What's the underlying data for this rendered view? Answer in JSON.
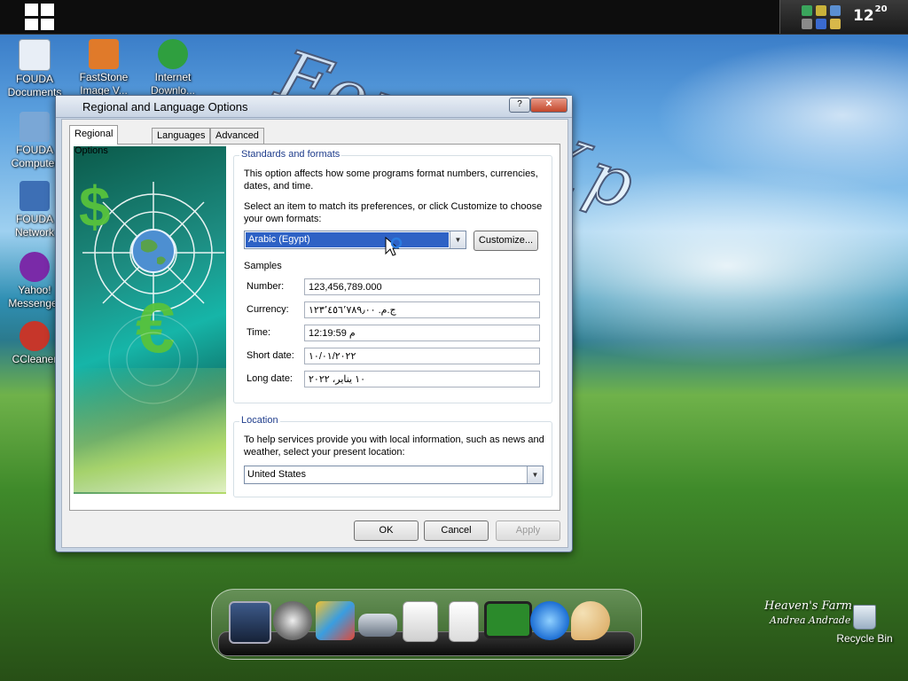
{
  "taskbar": {
    "clock_hour": "12",
    "clock_minute": "20"
  },
  "desktop_watermark": "Fouda Xp",
  "desktop_icons": [
    {
      "label": "FOUDA Documents",
      "icon": "documents-icon",
      "color": "#e8eef6"
    },
    {
      "label": "FastStone Image V...",
      "icon": "faststone-icon",
      "color": "#e07a2a"
    },
    {
      "label": "Internet Downlo...",
      "icon": "idm-icon",
      "color": "#2f9f3f"
    },
    {
      "label": "FOUDA Computer",
      "icon": "computer-icon",
      "color": "#7aa7d6"
    },
    {
      "label": "FOUDA Network",
      "icon": "network-icon",
      "color": "#3d6fb5"
    },
    {
      "label": "Yahoo! Messenger",
      "icon": "yahoo-messenger-icon",
      "color": "#7a2aa8"
    },
    {
      "label": "CCleaner",
      "icon": "ccleaner-icon",
      "color": "#c6362a"
    }
  ],
  "dialog": {
    "title": "Regional and Language Options",
    "help_label": "?",
    "close_label": "✕",
    "tabs": [
      "Regional Options",
      "Languages",
      "Advanced"
    ],
    "standards": {
      "legend": "Standards and formats",
      "desc": "This option affects how some programs format numbers, currencies, dates, and time.",
      "select_prompt": "Select an item to match its preferences, or click Customize to choose your own formats:",
      "selected_format": "Arabic (Egypt)",
      "customize_label": "Customize...",
      "samples_label": "Samples",
      "samples": [
        {
          "label": "Number:",
          "value": "123,456,789.000"
        },
        {
          "label": "Currency:",
          "value": "ج.م.‏ ١٢٣٬٤٥٦٬٧٨٩٫٠٠"
        },
        {
          "label": "Time:",
          "value": "12:19:59 م"
        },
        {
          "label": "Short date:",
          "value": "١٠/٠١/٢٠٢٢"
        },
        {
          "label": "Long date:",
          "value": "١٠ يناير، ٢٠٢٢"
        }
      ]
    },
    "location": {
      "legend": "Location",
      "desc": "To help services provide you with local information, such as news and weather, select your present location:",
      "selected": "United States"
    },
    "buttons": {
      "ok": "OK",
      "cancel": "Cancel",
      "apply": "Apply"
    }
  },
  "dock_icons": [
    "monitor-icon",
    "settings-gear-icon",
    "photo-gallery-icon",
    "drive-icon",
    "removable-drive-icon",
    "recycle-can-icon",
    "display-icon",
    "internet-explorer-icon",
    "paint-palette-icon"
  ],
  "recycle_bin": {
    "label": "Recycle Bin"
  },
  "wallpaper_signature": {
    "line1": "Heaven's Farm",
    "line2": "Andrea Andrade"
  }
}
